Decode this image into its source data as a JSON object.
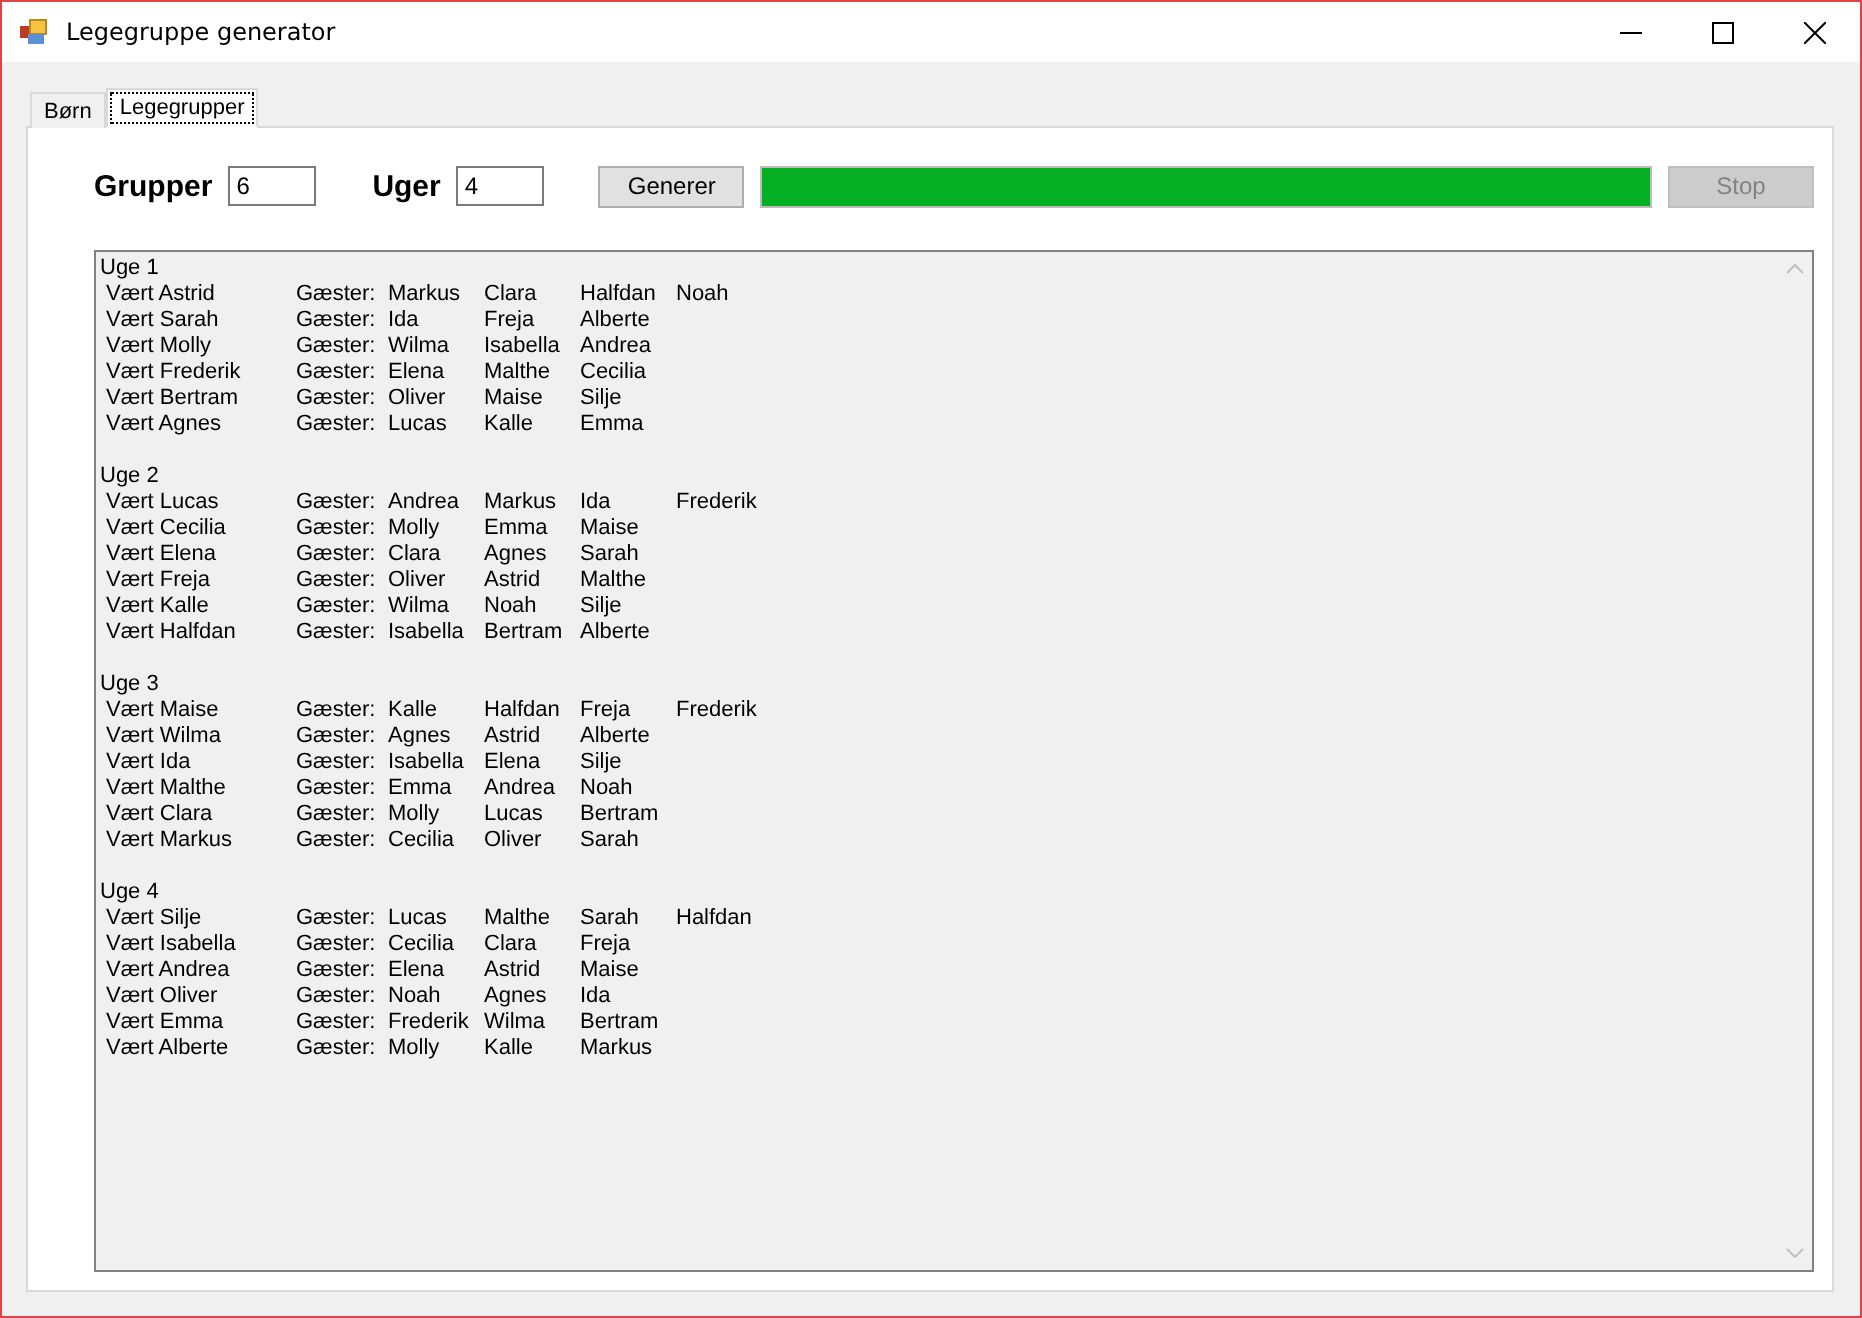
{
  "window": {
    "title": "Legegruppe generator"
  },
  "tabs": [
    {
      "label": "Børn",
      "selected": false
    },
    {
      "label": "Legegrupper",
      "selected": true
    }
  ],
  "controls": {
    "groups_label": "Grupper",
    "groups_value": "6",
    "weeks_label": "Uger",
    "weeks_value": "4",
    "generate_button": "Generer",
    "progress": {
      "level": 1
    },
    "stop_button": {
      "label": "Stop",
      "disabled": true
    }
  },
  "output": {
    "weeks": [
      {
        "title": "Uge 1",
        "rows": [
          {
            "host": "Vært Astrid",
            "label": "Gæster:",
            "guests": [
              "Markus",
              "Clara",
              "Halfdan",
              "Noah"
            ]
          },
          {
            "host": "Vært Sarah",
            "label": "Gæster:",
            "guests": [
              "Ida",
              "Freja",
              "Alberte"
            ]
          },
          {
            "host": "Vært Molly",
            "label": "Gæster:",
            "guests": [
              "Wilma",
              "Isabella",
              "Andrea"
            ]
          },
          {
            "host": "Vært Frederik",
            "label": "Gæster:",
            "guests": [
              "Elena",
              "Malthe",
              "Cecilia"
            ]
          },
          {
            "host": "Vært Bertram",
            "label": "Gæster:",
            "guests": [
              "Oliver",
              "Maise",
              "Silje"
            ]
          },
          {
            "host": "Vært Agnes",
            "label": "Gæster:",
            "guests": [
              "Lucas",
              "Kalle",
              "Emma"
            ]
          }
        ]
      },
      {
        "title": "Uge 2",
        "rows": [
          {
            "host": "Vært Lucas",
            "label": "Gæster:",
            "guests": [
              "Andrea",
              "Markus",
              "Ida",
              "Frederik"
            ]
          },
          {
            "host": "Vært Cecilia",
            "label": "Gæster:",
            "guests": [
              "Molly",
              "Emma",
              "Maise"
            ]
          },
          {
            "host": "Vært Elena",
            "label": "Gæster:",
            "guests": [
              "Clara",
              "Agnes",
              "Sarah"
            ]
          },
          {
            "host": "Vært Freja",
            "label": "Gæster:",
            "guests": [
              "Oliver",
              "Astrid",
              "Malthe"
            ]
          },
          {
            "host": "Vært Kalle",
            "label": "Gæster:",
            "guests": [
              "Wilma",
              "Noah",
              "Silje"
            ]
          },
          {
            "host": "Vært Halfdan",
            "label": "Gæster:",
            "guests": [
              "Isabella",
              "Bertram",
              "Alberte"
            ]
          }
        ]
      },
      {
        "title": "Uge 3",
        "rows": [
          {
            "host": "Vært Maise",
            "label": "Gæster:",
            "guests": [
              "Kalle",
              "Halfdan",
              "Freja",
              "Frederik"
            ]
          },
          {
            "host": "Vært Wilma",
            "label": "Gæster:",
            "guests": [
              "Agnes",
              "Astrid",
              "Alberte"
            ]
          },
          {
            "host": "Vært Ida",
            "label": "Gæster:",
            "guests": [
              "Isabella",
              "Elena",
              "Silje"
            ]
          },
          {
            "host": "Vært Malthe",
            "label": "Gæster:",
            "guests": [
              "Emma",
              "Andrea",
              "Noah"
            ]
          },
          {
            "host": "Vært Clara",
            "label": "Gæster:",
            "guests": [
              "Molly",
              "Lucas",
              "Bertram"
            ]
          },
          {
            "host": "Vært Markus",
            "label": "Gæster:",
            "guests": [
              "Cecilia",
              "Oliver",
              "Sarah"
            ]
          }
        ]
      },
      {
        "title": "Uge 4",
        "rows": [
          {
            "host": "Vært Silje",
            "label": "Gæster:",
            "guests": [
              "Lucas",
              "Malthe",
              "Sarah",
              "Halfdan"
            ]
          },
          {
            "host": "Vært Isabella",
            "label": "Gæster:",
            "guests": [
              "Cecilia",
              "Clara",
              "Freja"
            ]
          },
          {
            "host": "Vært Andrea",
            "label": "Gæster:",
            "guests": [
              "Elena",
              "Astrid",
              "Maise"
            ]
          },
          {
            "host": "Vært Oliver",
            "label": "Gæster:",
            "guests": [
              "Noah",
              "Agnes",
              "Ida"
            ]
          },
          {
            "host": "Vært Emma",
            "label": "Gæster:",
            "guests": [
              "Frederik",
              "Wilma",
              "Bertram"
            ]
          },
          {
            "host": "Vært Alberte",
            "label": "Gæster:",
            "guests": [
              "Molly",
              "Kalle",
              "Markus"
            ]
          }
        ]
      }
    ]
  }
}
